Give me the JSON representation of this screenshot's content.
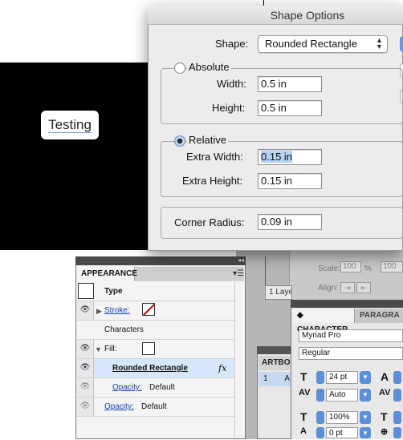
{
  "canvas": {
    "shape_text": "Testing"
  },
  "dialog": {
    "title": "Shape Options",
    "shape_label": "Shape:",
    "shape_value": "Rounded Rectangle",
    "absolute": {
      "label": "Absolute",
      "selected": false,
      "width_label": "Width:",
      "width_value": "0.5 in",
      "height_label": "Height:",
      "height_value": "0.5 in"
    },
    "relative": {
      "label": "Relative",
      "selected": true,
      "extra_width_label": "Extra Width:",
      "extra_width_value": "0.15 in",
      "extra_height_label": "Extra Height:",
      "extra_height_value": "0.15 in"
    },
    "corner_radius_label": "Corner Radius:",
    "corner_radius_value": "0.09 in"
  },
  "appearance": {
    "tab": "APPEARANCE",
    "type_label": "Type",
    "stroke_label": "Stroke:",
    "characters_label": "Characters",
    "fill_label": "Fill:",
    "effect_label": "Rounded Rectangle",
    "fx_label": "fx",
    "effect_opacity_label": "Opacity:",
    "effect_opacity_value": "Default",
    "opacity_label": "Opacity:",
    "opacity_value": "Default"
  },
  "background_panels": {
    "scale_label": "Scale:",
    "scale_value": "100",
    "scale_percent": "%",
    "scale_value_2": "100",
    "align_label": "Align:",
    "layers_tab": "1 Laye",
    "artboards_tab": "ARTBOA",
    "artboards_row_number": "1",
    "artboards_row_text": "A"
  },
  "character": {
    "tab": "CHARACTER",
    "paragraph_tab": "PARAGRA",
    "extra_tab": "O",
    "font_family": "Myriad Pro",
    "font_style": "Regular",
    "font_size": "24 pt",
    "kerning": "Auto",
    "vertical_scale": "100%",
    "baseline_shift": "0 pt"
  },
  "colors": {
    "canvas_black": "#000000",
    "selection_blue": "#d6e6fb",
    "link_blue": "#1a3fb3",
    "stroke_none_red": "#cc0000",
    "spin_blue": "#5c8fd6"
  }
}
